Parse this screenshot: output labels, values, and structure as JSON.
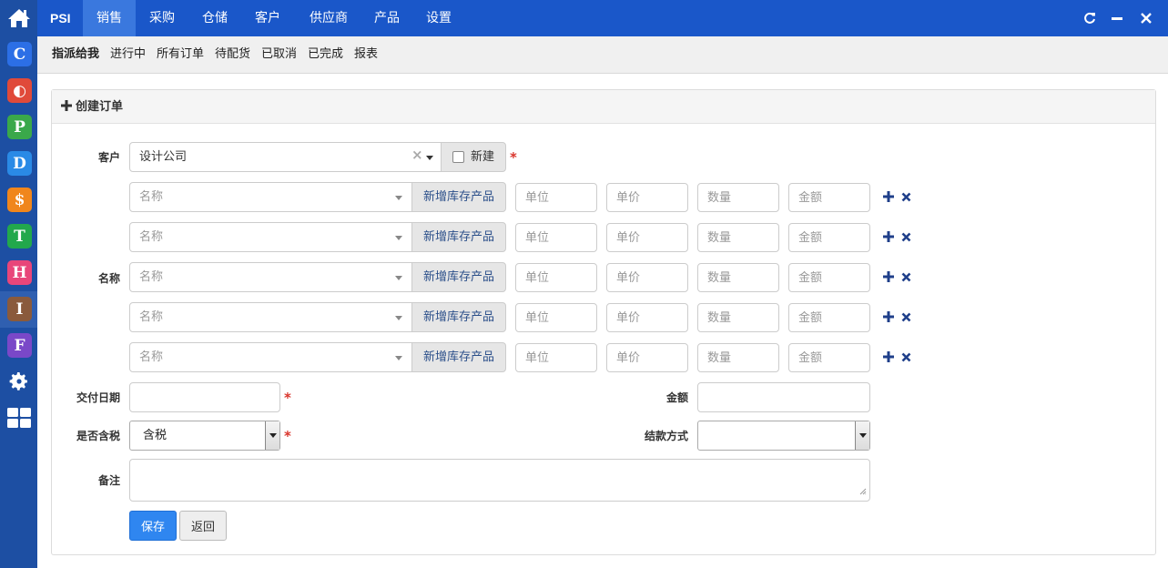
{
  "topnav": {
    "brand": "PSI",
    "tabs": [
      "销售",
      "采购",
      "仓储",
      "客户",
      "供应商",
      "产品",
      "设置"
    ],
    "active_tab": "销售"
  },
  "rail": {
    "apps": [
      {
        "letter": "C",
        "color": "#2c6fe6"
      },
      {
        "letter": "◐",
        "color": "#e04a3a"
      },
      {
        "letter": "P",
        "color": "#3aa84a"
      },
      {
        "letter": "D",
        "color": "#2a8ae6"
      },
      {
        "letter": "$",
        "color": "#f0861c"
      },
      {
        "letter": "T",
        "color": "#22a84c"
      },
      {
        "letter": "H",
        "color": "#e8467a"
      },
      {
        "letter": "I",
        "color": "#8a5a3c"
      },
      {
        "letter": "F",
        "color": "#7a48c8"
      }
    ]
  },
  "subnav": {
    "items": [
      "指派给我",
      "进行中",
      "所有订单",
      "待配货",
      "已取消",
      "已完成",
      "报表"
    ],
    "active": "指派给我"
  },
  "panel": {
    "title": "创建订单"
  },
  "form": {
    "customer_label": "客户",
    "customer_value": "设计公司",
    "new_label": "新建",
    "name_label": "名称",
    "item_rows": [
      {
        "name_placeholder": "名称",
        "add_product": "新增库存产品",
        "unit_placeholder": "单位",
        "price_placeholder": "单价",
        "qty_placeholder": "数量",
        "amount_placeholder": "金额"
      },
      {
        "name_placeholder": "名称",
        "add_product": "新增库存产品",
        "unit_placeholder": "单位",
        "price_placeholder": "单价",
        "qty_placeholder": "数量",
        "amount_placeholder": "金额"
      },
      {
        "name_placeholder": "名称",
        "add_product": "新增库存产品",
        "unit_placeholder": "单位",
        "price_placeholder": "单价",
        "qty_placeholder": "数量",
        "amount_placeholder": "金额"
      },
      {
        "name_placeholder": "名称",
        "add_product": "新增库存产品",
        "unit_placeholder": "单位",
        "price_placeholder": "单价",
        "qty_placeholder": "数量",
        "amount_placeholder": "金额"
      },
      {
        "name_placeholder": "名称",
        "add_product": "新增库存产品",
        "unit_placeholder": "单位",
        "price_placeholder": "单价",
        "qty_placeholder": "数量",
        "amount_placeholder": "金额"
      }
    ],
    "delivery_date_label": "交付日期",
    "amount_label": "金额",
    "tax_label": "是否含税",
    "tax_value": "含税",
    "payment_label": "结款方式",
    "payment_value": "",
    "remark_label": "备注",
    "required_mark": "*",
    "save_label": "保存",
    "back_label": "返回"
  },
  "colors": {
    "rail": "#1d4fa3",
    "topnav": "#1a57c9",
    "active_tab": "#3a78de",
    "primary_button": "#2f86f0",
    "required": "#d9352c"
  }
}
